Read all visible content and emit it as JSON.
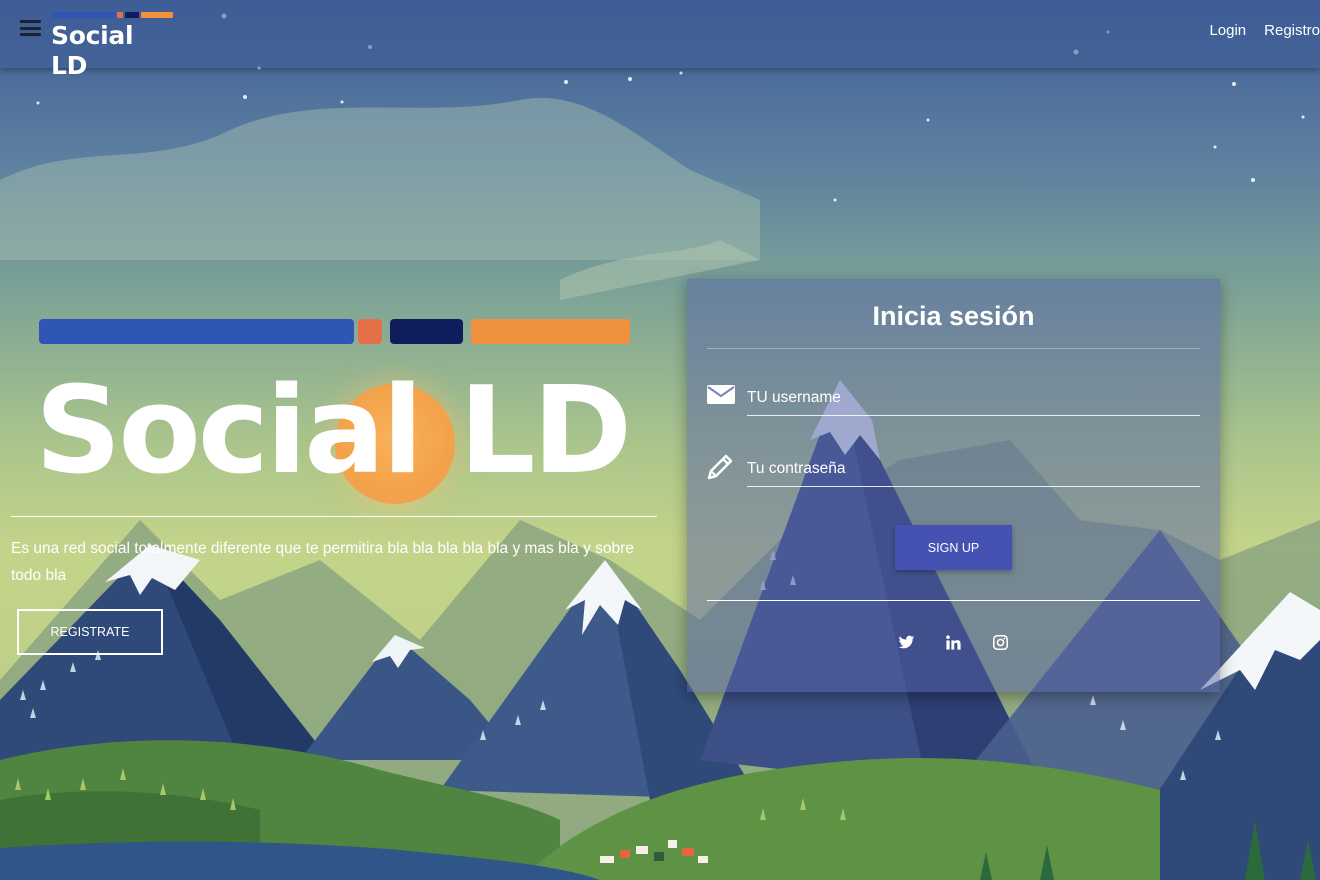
{
  "navbar": {
    "logo_text": "Social LD",
    "links": [
      {
        "label": "Login"
      },
      {
        "label": "Registro"
      }
    ]
  },
  "brand_colors": {
    "blue": "#2f55b5",
    "coral": "#e57048",
    "navy": "#101d5c",
    "orange": "#f0913d",
    "sun": "#f3a24a"
  },
  "hero": {
    "title": "Social LD",
    "description": "Es una red social totalmente diferente que te permitira bla bla bla bla bla y mas bla y sobre todo bla",
    "register_button": "REGISTRATE"
  },
  "login_card": {
    "title": "Inicia sesión",
    "username_placeholder": "TU username",
    "password_placeholder": "Tu contraseña",
    "submit_button": "SIGN UP",
    "socials": [
      "twitter-icon",
      "linkedin-icon",
      "instagram-icon"
    ]
  }
}
